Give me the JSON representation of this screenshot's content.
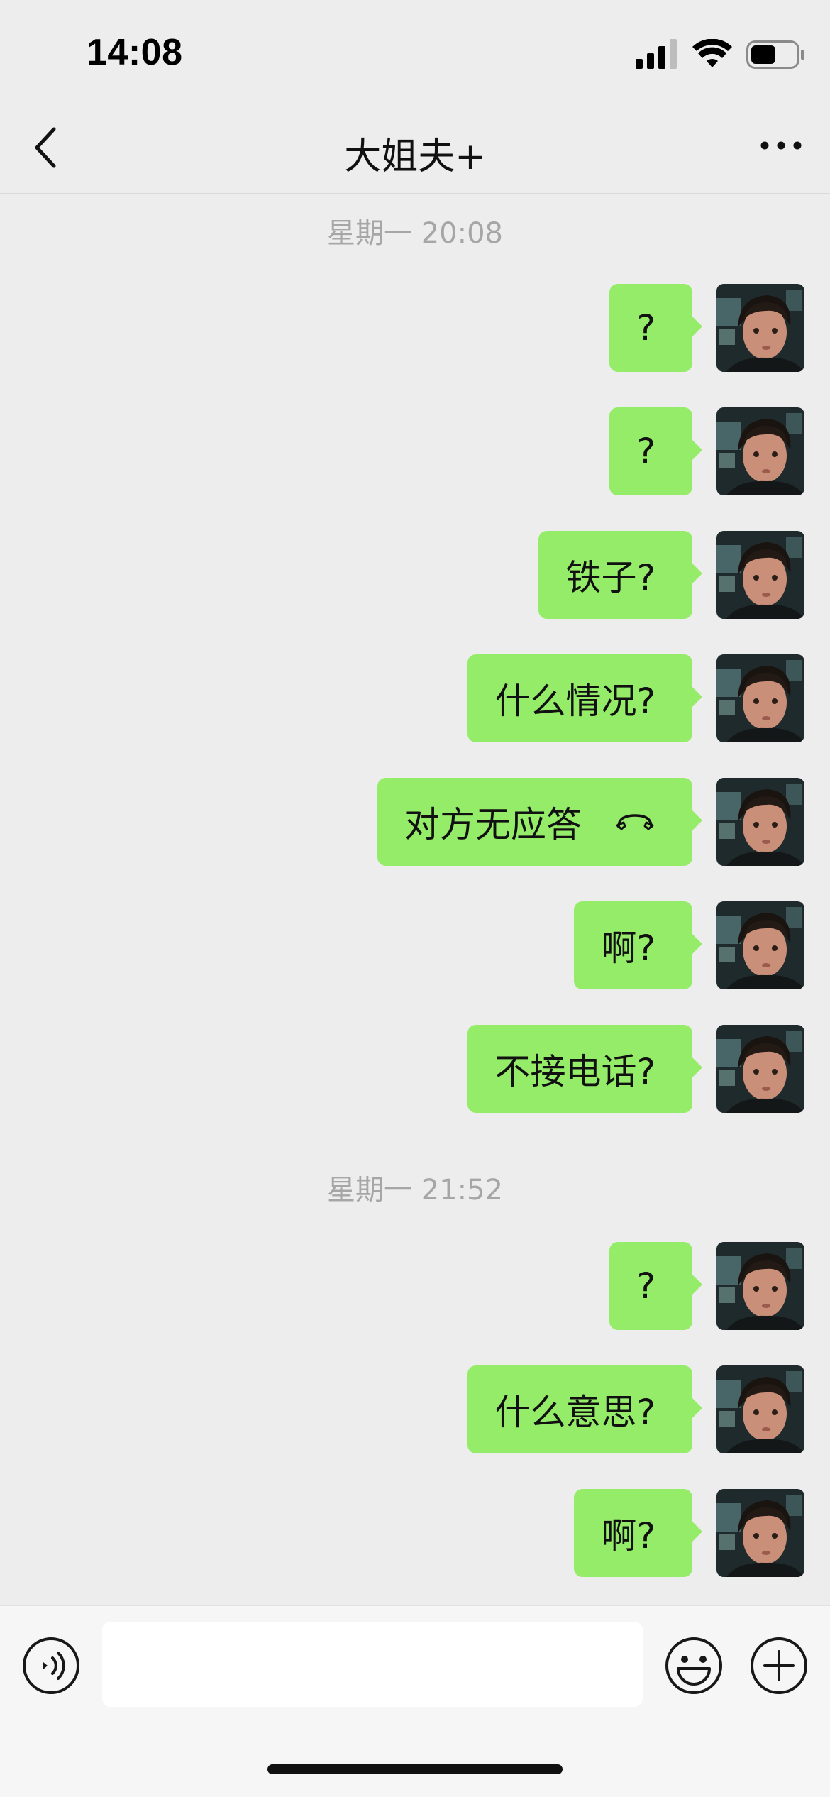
{
  "status_bar": {
    "time": "14:08",
    "icons": [
      "cellular-signal-icon",
      "wifi-icon",
      "battery-icon"
    ],
    "battery_level": 0.55
  },
  "nav": {
    "back_icon": "chevron-left-icon",
    "title": "大姐夫+",
    "more_icon": "ellipsis-icon"
  },
  "chat": {
    "groups": [
      {
        "timestamp": "星期一 20:08",
        "messages": [
          {
            "text": "?",
            "from": "me"
          },
          {
            "text": "?",
            "from": "me"
          },
          {
            "text": "铁子?",
            "from": "me"
          },
          {
            "text": "什么情况?",
            "from": "me"
          },
          {
            "text": "对方无应答",
            "from": "me",
            "icon": "phone-hangup-icon"
          },
          {
            "text": "啊?",
            "from": "me"
          },
          {
            "text": "不接电话?",
            "from": "me"
          }
        ]
      },
      {
        "timestamp": "星期一 21:52",
        "messages": [
          {
            "text": "?",
            "from": "me"
          },
          {
            "text": "什么意思?",
            "from": "me"
          },
          {
            "text": "啊?",
            "from": "me"
          }
        ]
      }
    ]
  },
  "input_bar": {
    "voice_icon": "voice-input-icon",
    "text_value": "",
    "emoji_icon": "emoji-icon",
    "plus_icon": "plus-icon"
  },
  "colors": {
    "background": "#ededed",
    "bubble_green": "#95ec69",
    "timestamp_gray": "#a6a6a6"
  }
}
